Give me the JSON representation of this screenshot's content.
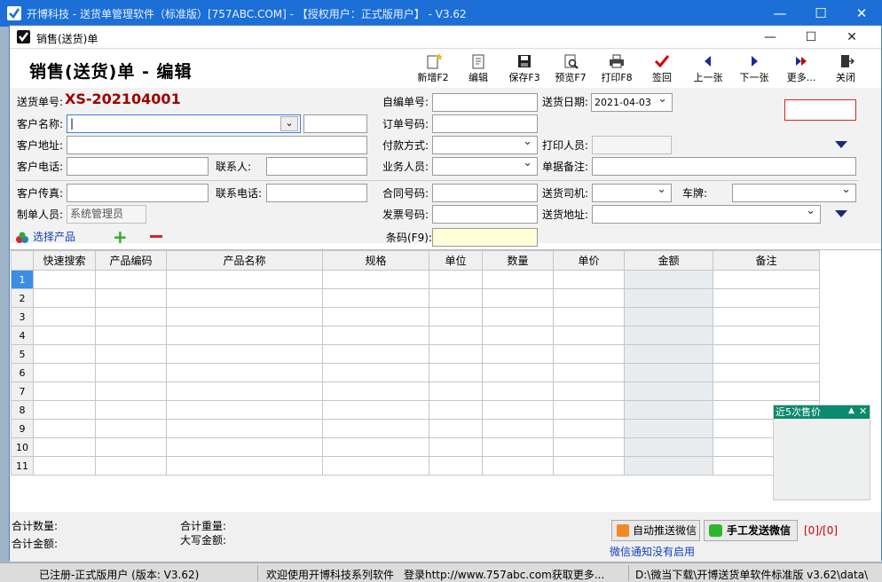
{
  "app": {
    "title": "开博科技 - 送货单管理软件（标准版）[757ABC.COM] - 【授权用户：正式版用户】 - V3.62"
  },
  "dialog": {
    "title": "销售(送货)单",
    "heading": "销售(送货)单 - 编辑"
  },
  "toolbar": [
    {
      "label": "新增F2",
      "icon": "new-icon"
    },
    {
      "label": "编辑",
      "icon": "edit-icon"
    },
    {
      "label": "保存F3",
      "icon": "save-icon"
    },
    {
      "label": "预览F7",
      "icon": "preview-icon"
    },
    {
      "label": "打印F8",
      "icon": "print-icon"
    },
    {
      "label": "签回",
      "icon": "check-icon"
    },
    {
      "label": "上一张",
      "icon": "prev-icon"
    },
    {
      "label": "下一张",
      "icon": "next-icon"
    },
    {
      "label": "更多...",
      "icon": "more-icon"
    },
    {
      "label": "关闭",
      "icon": "close-door-icon"
    }
  ],
  "form": {
    "order_no_label": "送货单号:",
    "order_no": "XS-202104001",
    "self_no_label": "自编单号:",
    "date_label": "送货日期:",
    "date_value": "2021-04-03",
    "customer_label": "客户名称:",
    "po_label": "订单号码:",
    "addr_label": "客户地址:",
    "pay_label": "付款方式:",
    "printer_label": "打印人员:",
    "phone_label": "客户电话:",
    "contact_label": "联系人:",
    "sales_label": "业务人员:",
    "remark_label": "单据备注:",
    "fax_label": "客户传真:",
    "contact_phone_label": "联系电话:",
    "contract_label": "合同号码:",
    "driver_label": "送货司机:",
    "plate_label": "车牌:",
    "maker_label": "制单人员:",
    "maker_value": "系统管理员",
    "invoice_label": "发票号码:",
    "ship_addr_label": "送货地址:",
    "select_product": "选择产品",
    "barcode_label": "条码(F9):"
  },
  "grid": {
    "columns": [
      "快速搜索",
      "产品编码",
      "产品名称",
      "规格",
      "单位",
      "数量",
      "单价",
      "金额",
      "备注"
    ],
    "rows": [
      "1",
      "2",
      "3",
      "4",
      "5",
      "6",
      "7",
      "8",
      "9",
      "10",
      "11"
    ]
  },
  "popup": {
    "title": "近5次售价"
  },
  "footer": {
    "total_qty": "合计数量:",
    "total_weight": "合计重量:",
    "total_amount": "合计金额:",
    "amount_upper": "大写金额:",
    "auto_push": "自动推送微信",
    "manual_send": "手工发送微信",
    "counter": "[0]/[0]",
    "wechat_notice": "微信通知没有启用"
  },
  "status": {
    "reg": "已注册-正式版用户 (版本: V3.62)",
    "welcome": "欢迎使用开博科技系列软件",
    "login": "登录http://www.757abc.com获取更多...",
    "path": "D:\\微当下载\\开博送货单软件标准版 v3.62\\data\\"
  },
  "colors": {
    "title_bar": "#1b6fd6",
    "order_no": "#a00000",
    "link": "#1040c0",
    "popup_header": "#0b8a6d"
  }
}
